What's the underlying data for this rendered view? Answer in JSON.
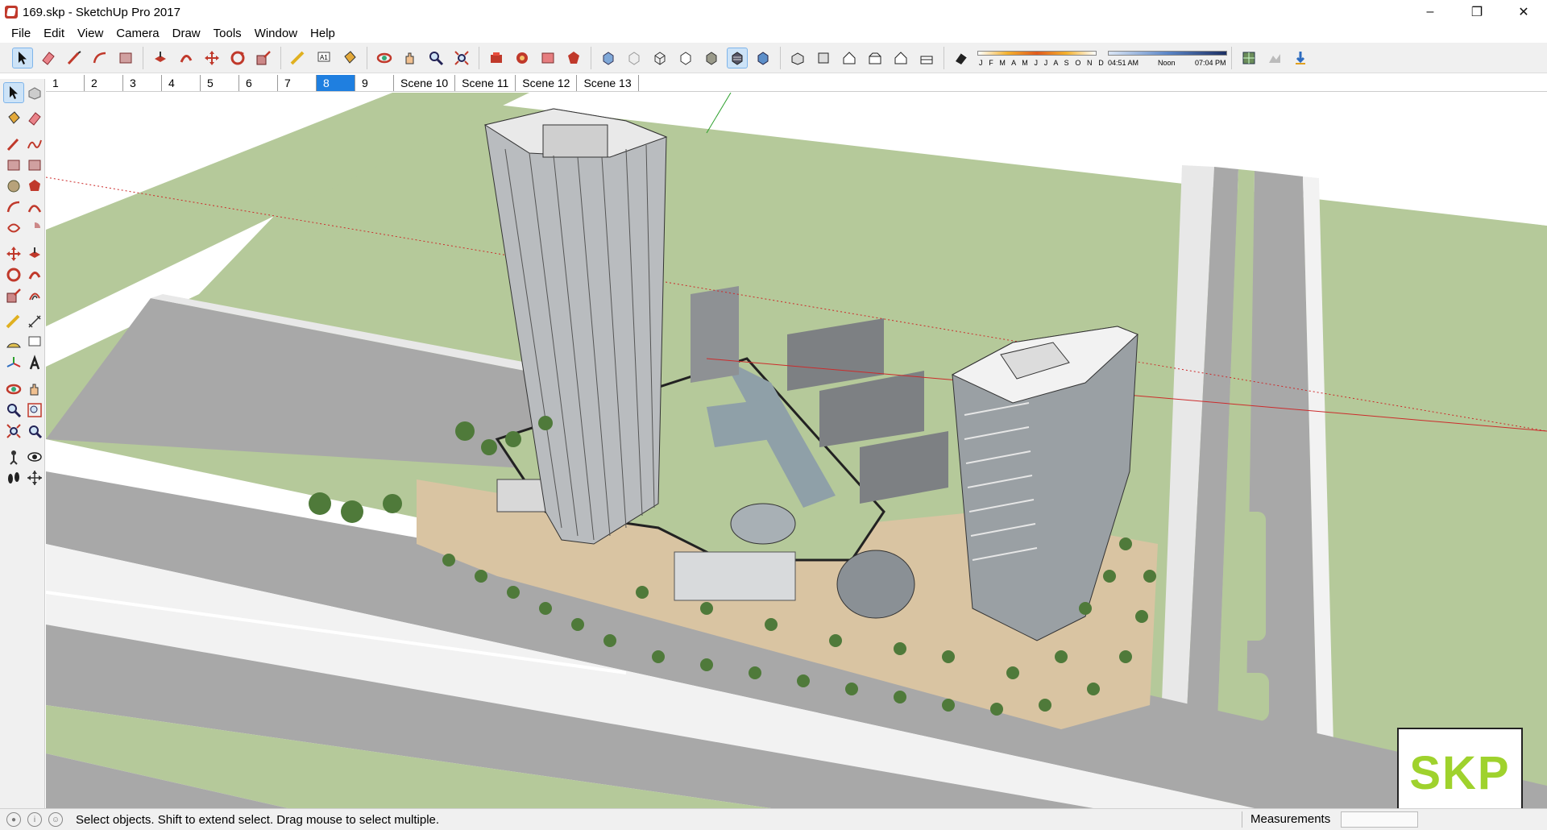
{
  "window": {
    "title": "169.skp - SketchUp Pro 2017",
    "controls": [
      "minimize",
      "restore",
      "close"
    ]
  },
  "menu": [
    "File",
    "Edit",
    "View",
    "Camera",
    "Draw",
    "Tools",
    "Window",
    "Help"
  ],
  "toolbar": {
    "shadow_months": "J F M A M J J A S O N D",
    "shadow_time_start": "04:51 AM",
    "shadow_time_mid": "Noon",
    "shadow_time_end": "07:04 PM"
  },
  "scenes": {
    "tabs": [
      "1",
      "2",
      "3",
      "4",
      "5",
      "6",
      "7",
      "8",
      "9",
      "Scene 10",
      "Scene 11",
      "Scene 12",
      "Scene 13"
    ],
    "active": "8"
  },
  "status": {
    "hint": "Select objects. Shift to extend select. Drag mouse to select multiple.",
    "measurements_label": "Measurements",
    "measurements_value": ""
  },
  "watermark": "SKP",
  "colors": {
    "grass": "#b5c99a",
    "road": "#a8a8a8",
    "plaza": "#d9c4a2",
    "tower": "#b9bcbf",
    "axis_red": "#cc2b2b",
    "axis_green": "#2ca02c",
    "active_tab": "#1f7fe0"
  }
}
